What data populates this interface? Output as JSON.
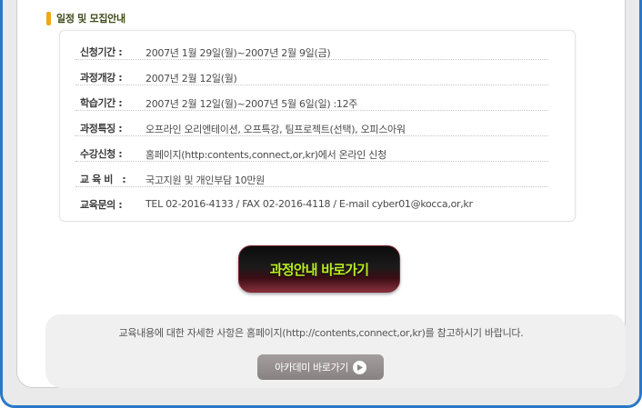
{
  "section_title": "일정 및 모집안내",
  "info": [
    {
      "label": "신청기간 :",
      "value": "2007년 1월 29일(월)~2007년 2월 9일(금)"
    },
    {
      "label": "과정개강 :",
      "value": "2007년 2월 12일(월)"
    },
    {
      "label": "학습기간 :",
      "value": "2007년 2월 12일(월)~2007년 5월 6일(일) :12주"
    },
    {
      "label": "과정특징 :",
      "value": "오프라인 오리엔테이션, 오프특강, 팀프로젝트(선택), 오피스아워"
    },
    {
      "label": "수강신청 :",
      "value": "홈페이지(http:contents,connect,or,kr)에서 온라인 신청"
    },
    {
      "label": "교 육 비   :",
      "value": "국고지원 및 개인부담 10만원"
    },
    {
      "label": "교육문의 :",
      "value": "TEL 02-2016-4133 / FAX 02-2016-4118 / E-mail cyber01@kocca,or,kr"
    }
  ],
  "main_button": {
    "label": "과정안내 바로가기"
  },
  "notice": {
    "text": "교육내용에 대한 자세한 사항은 홈페이지(http://contents,connect,or,kr)를 참고하시기 바랍니다."
  },
  "academy_button": {
    "label": "아카데미 바로가기",
    "icon": "arrow-circle-icon"
  },
  "colors": {
    "frame": "#2a78c8",
    "title_bar": "#f3a712",
    "button_text": "#b9ef20"
  }
}
